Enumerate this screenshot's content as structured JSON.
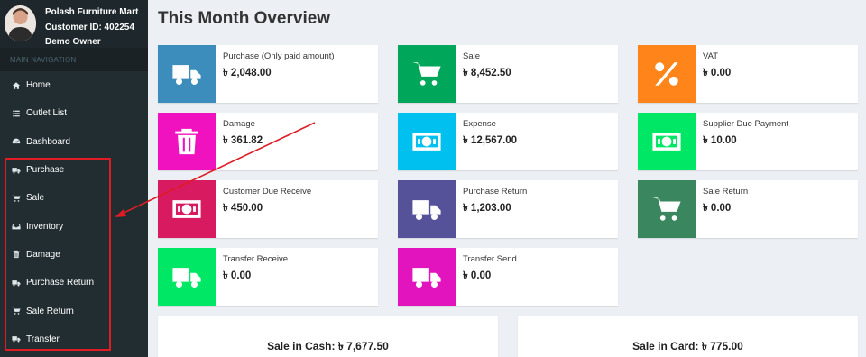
{
  "user": {
    "name": "Polash Furniture Mart",
    "customer_id": "Customer ID: 402254",
    "role": "Demo Owner"
  },
  "nav": {
    "header": "MAIN NAVIGATION",
    "items": [
      {
        "label": "Home",
        "icon": "home-icon"
      },
      {
        "label": "Outlet List",
        "icon": "list-icon"
      },
      {
        "label": "Dashboard",
        "icon": "dashboard-icon"
      },
      {
        "label": "Purchase",
        "icon": "truck-icon"
      },
      {
        "label": "Sale",
        "icon": "cart-icon"
      },
      {
        "label": "Inventory",
        "icon": "inbox-icon"
      },
      {
        "label": "Damage",
        "icon": "trash-icon"
      },
      {
        "label": "Purchase Return",
        "icon": "truck-icon"
      },
      {
        "label": "Sale Return",
        "icon": "cart-icon"
      },
      {
        "label": "Transfer",
        "icon": "truck-icon"
      }
    ]
  },
  "main": {
    "title": "This Month Overview",
    "boxes": [
      {
        "label": "Purchase (Only paid amount)",
        "value": "৳ 2,048.00",
        "icon": "truck-icon",
        "color": "#3c8dbc"
      },
      {
        "label": "Sale",
        "value": "৳ 8,452.50",
        "icon": "cart-icon",
        "color": "#00a65a"
      },
      {
        "label": "VAT",
        "value": "৳ 0.00",
        "icon": "percent-icon",
        "color": "#ff851b"
      },
      {
        "label": "Damage",
        "value": "৳ 361.82",
        "icon": "trash-icon",
        "color": "#f012be"
      },
      {
        "label": "Expense",
        "value": "৳ 12,567.00",
        "icon": "money-icon",
        "color": "#00c0ef"
      },
      {
        "label": "Supplier Due Payment",
        "value": "৳ 10.00",
        "icon": "money-icon",
        "color": "#00e765"
      },
      {
        "label": "Customer Due Receive",
        "value": "৳ 450.00",
        "icon": "money-icon",
        "color": "#d81b60"
      },
      {
        "label": "Purchase Return",
        "value": "৳ 1,203.00",
        "icon": "truck-icon",
        "color": "#555299"
      },
      {
        "label": "Sale Return",
        "value": "৳ 0.00",
        "icon": "cart-icon",
        "color": "#39865f"
      },
      {
        "label": "Transfer Receive",
        "value": "৳ 0.00",
        "icon": "truck-icon",
        "color": "#00e765"
      },
      {
        "label": "Transfer Send",
        "value": "৳ 0.00",
        "icon": "truck-icon",
        "color": "#e214be"
      }
    ],
    "summary": {
      "cash_label": "Sale in Cash:",
      "cash_value": "৳ 7,677.50",
      "card_label": "Sale in Card:",
      "card_value": "৳ 775.00"
    }
  },
  "colors": {
    "sidebar_bg": "#222d32",
    "highlight": "#e01b24"
  }
}
